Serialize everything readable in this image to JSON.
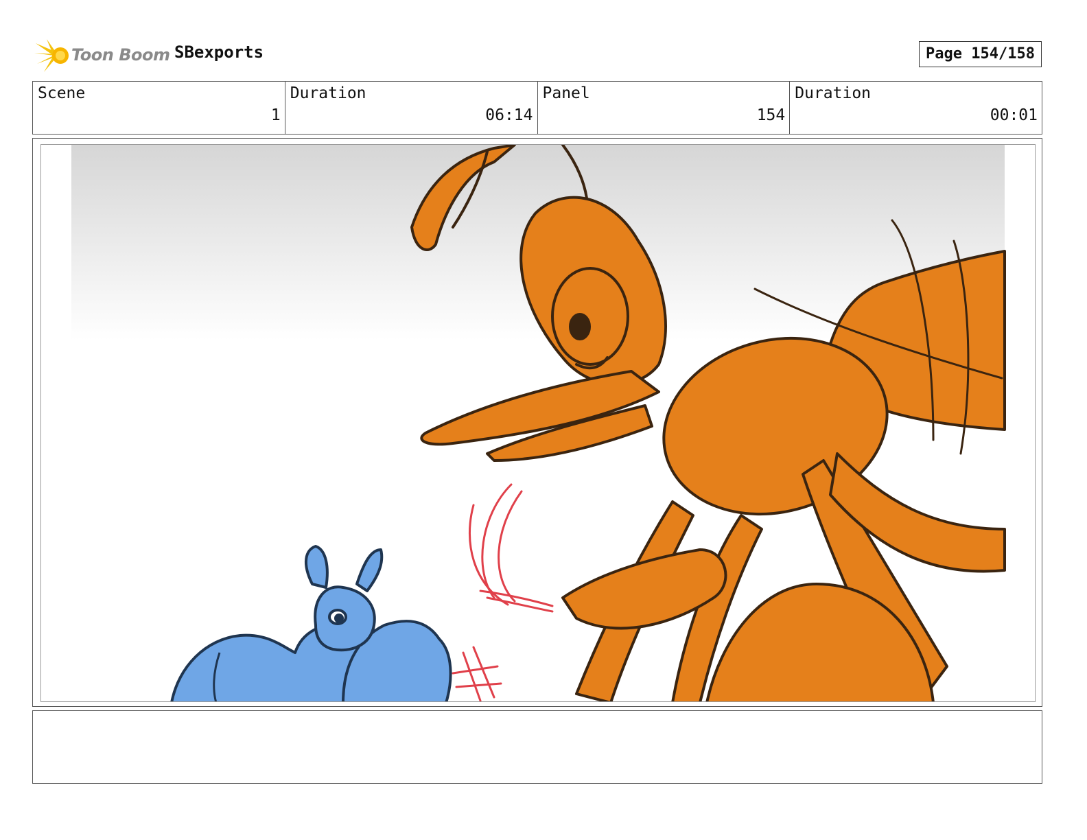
{
  "header": {
    "logo_text": "Toon Boom",
    "project_title": "SBexports",
    "page_label": "Page 154/158"
  },
  "info": {
    "scene_label": "Scene",
    "scene_value": "1",
    "scene_duration_label": "Duration",
    "scene_duration_value": "06:14",
    "panel_label": "Panel",
    "panel_value": "154",
    "panel_duration_label": "Duration",
    "panel_duration_value": "00:01"
  },
  "notes": {
    "text": ""
  },
  "colors": {
    "ant_orange": "#e5801b",
    "bug_blue": "#6fa6e6",
    "sketch_brown": "#3a2410",
    "sketch_navy": "#1f3550",
    "motion_red": "#e0404a",
    "logo_yellow": "#f4c20d"
  }
}
